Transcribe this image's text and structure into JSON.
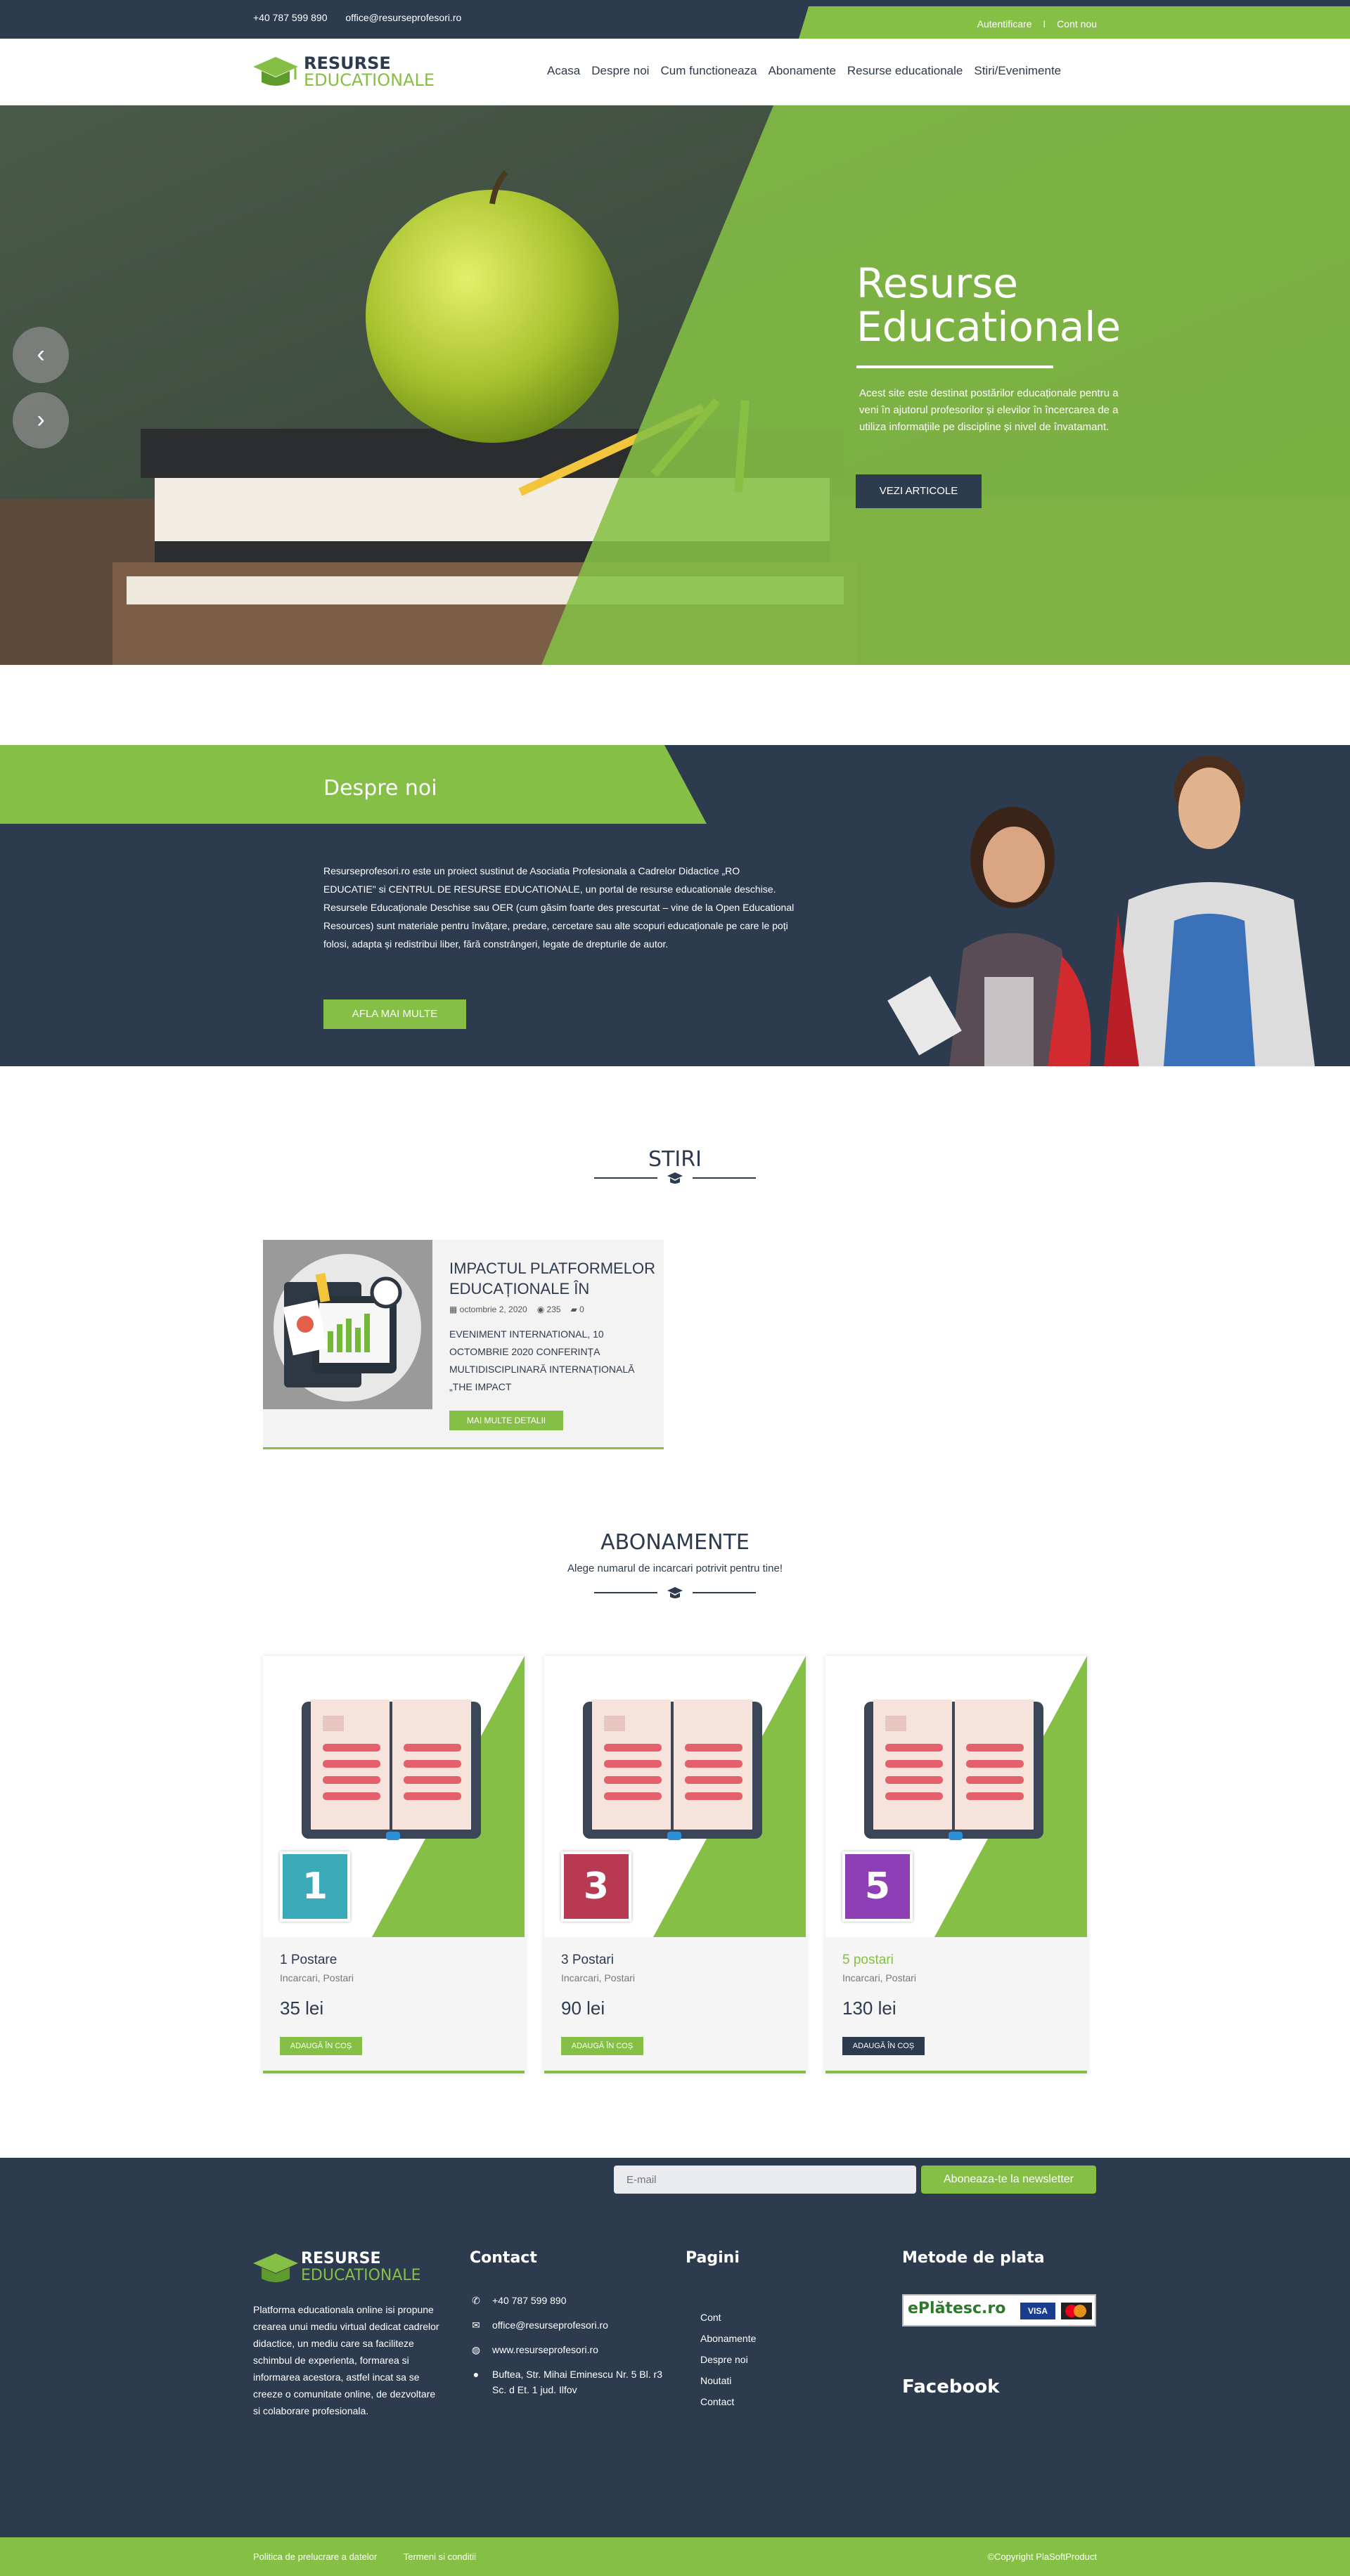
{
  "topbar": {
    "phone": "+40 787 599 890",
    "email": "office@resurseprofesori.ro",
    "login": "Autentificare",
    "separator": "I",
    "register": "Cont nou"
  },
  "logo": {
    "line1": "RESURSE",
    "line2": "EDUCATIONALE"
  },
  "nav": {
    "items": [
      "Acasa",
      "Despre noi",
      "Cum functioneaza",
      "Abonamente",
      "Resurse educationale",
      "Stiri/Evenimente"
    ]
  },
  "hero": {
    "title_line1": "Resurse",
    "title_line2": "Educationale",
    "description": "Acest site este destinat postărilor educaționale pentru a veni în ajutorul profesorilor și elevilor în încercarea de a utiliza informațiile pe discipline și nivel de învatamant.",
    "cta": "VEZI ARTICOLE",
    "prev_icon": "chevron-left-icon",
    "next_icon": "chevron-right-icon"
  },
  "about": {
    "heading": "Despre noi",
    "text": "Resurseprofesori.ro este un proiect sustinut de Asociatia Profesionala a Cadrelor Didactice „RO EDUCATIE\" si CENTRUL DE RESURSE EDUCATIONALE, un portal de resurse educationale deschise. Resursele Educaționale Deschise sau OER (cum găsim foarte des prescurtat – vine de la Open Educational Resources) sunt materiale pentru învățare, predare, cercetare sau alte scopuri educaționale pe care le poți folosi, adapta și redistribui liber, fără constrângeri, legate de drepturile de autor.",
    "button": "AFLA MAI MULTE"
  },
  "news": {
    "heading": "STIRI",
    "card": {
      "title": "IMPACTUL PLATFORMELOR EDUCAȚIONALE ÎN",
      "date": "octombrie 2, 2020",
      "views": "235",
      "comments": "0",
      "excerpt": "EVENIMENT INTERNATIONAL, 10 OCTOMBRIE 2020 CONFERINȚA MULTIDISCIPLINARĂ INTERNAȚIONALĂ „THE IMPACT",
      "button": "MAI MULTE DETALII"
    }
  },
  "pricing": {
    "heading": "ABONAMENTE",
    "subheading": "Alege numarul de incarcari potrivit pentru tine!",
    "plans": [
      {
        "number": "1",
        "name": "1 Postare",
        "sub": "Incarcari, Postari",
        "price": "35 lei",
        "button": "ADAUGĂ ÎN COȘ",
        "badge_color": "#3aa9b8",
        "button_color": "#85bf45",
        "name_color": "#2d3b4e"
      },
      {
        "number": "3",
        "name": "3 Postari",
        "sub": "Incarcari, Postari",
        "price": "90 lei",
        "button": "ADAUGĂ ÎN COȘ",
        "badge_color": "#b83a52",
        "button_color": "#85bf45",
        "name_color": "#2d3b4e"
      },
      {
        "number": "5",
        "name": "5 postari",
        "sub": "Incarcari, Postari",
        "price": "130 lei",
        "button": "ADAUGĂ ÎN COȘ",
        "badge_color": "#8e3fb5",
        "button_color": "#2d3b4e",
        "name_color": "#85bf45"
      }
    ]
  },
  "footer": {
    "email_placeholder": "E-mail",
    "subscribe": "Aboneaza-te la newsletter",
    "about_text": "Platforma educationala online isi propune crearea unui mediu virtual dedicat cadrelor didactice, un mediu care sa faciliteze schimbul de experienta, formarea si informarea acestora, astfel incat sa se creeze o comunitate online, de dezvoltare si colaborare profesionala.",
    "contact_title": "Contact",
    "contact": {
      "phone": "+40 787 599 890",
      "email": "office@resurseprofesori.ro",
      "website": "www.resurseprofesori.ro",
      "address": "Buftea, Str. Mihai Eminescu Nr. 5 Bl. r3 Sc. d Et. 1 jud. Ilfov"
    },
    "pages_title": "Pagini",
    "pages": [
      "Cont",
      "Abonamente",
      "Despre noi",
      "Noutati",
      "Contact"
    ],
    "payment_title": "Metode de plata",
    "payment_brand": "ePlătesc.ro",
    "payment_visa": "VISA",
    "facebook_title": "Facebook"
  },
  "bottombar": {
    "privacy": "Politica de prelucrare a datelor",
    "terms": "Termeni si conditii",
    "copyright": "©Copyright PlaSoftProduct"
  },
  "colors": {
    "navy": "#2d3b4e",
    "green": "#85bf45"
  }
}
